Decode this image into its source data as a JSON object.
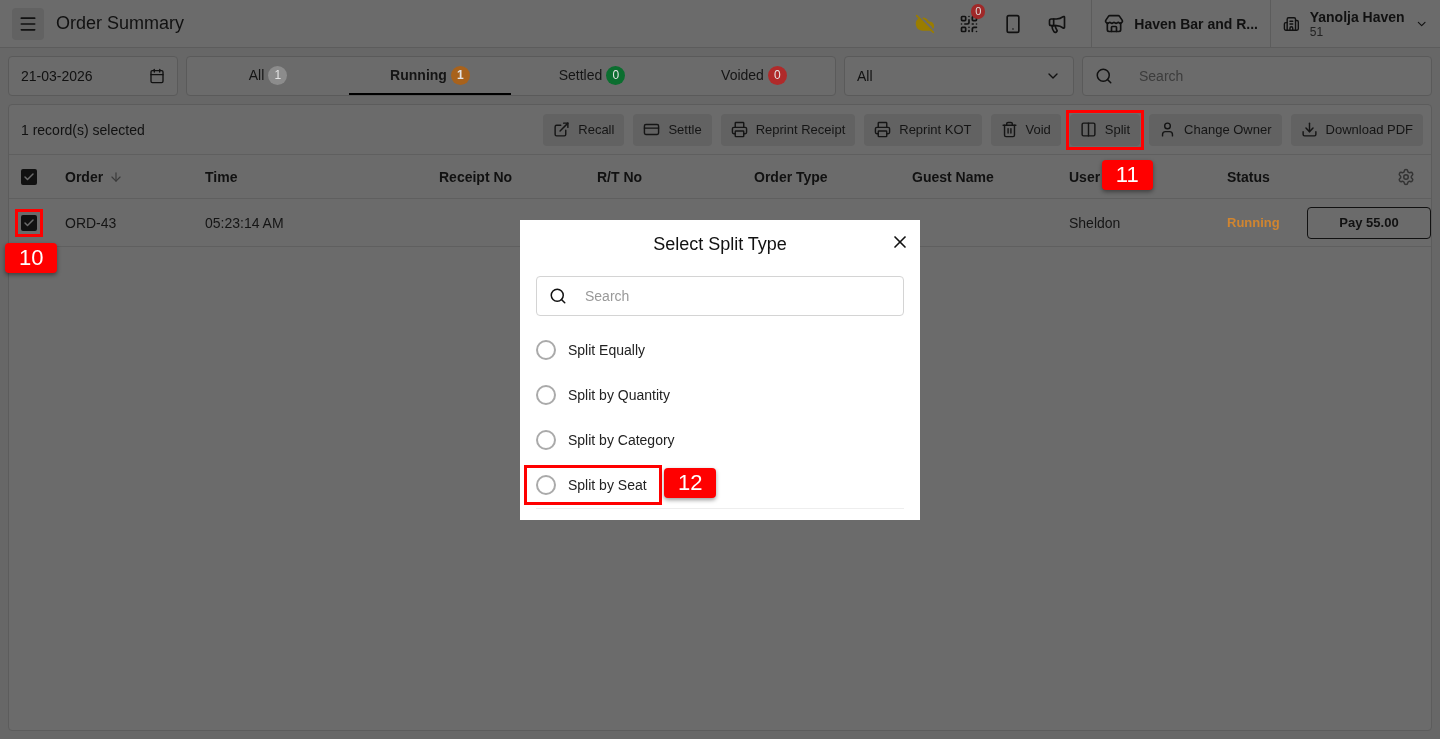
{
  "header": {
    "title": "Order Summary",
    "notifications_badge": "0",
    "outlet": "Haven Bar and R...",
    "account": {
      "name": "Yanolja Haven",
      "id": "51"
    }
  },
  "filters": {
    "date": "21-03-2026",
    "tabs": [
      {
        "label": "All",
        "count": "1",
        "color": "#8c8c8c",
        "selected": false
      },
      {
        "label": "Running",
        "count": "1",
        "color": "#a8621c",
        "selected": true
      },
      {
        "label": "Settled",
        "count": "0",
        "color": "#0b6e2f",
        "selected": false
      },
      {
        "label": "Voided",
        "count": "0",
        "color": "#b02a2a",
        "selected": false
      }
    ],
    "type_select": "All",
    "search": {
      "placeholder": "Search"
    }
  },
  "toolbar": {
    "selection": "1 record(s) selected",
    "actions": [
      {
        "label": "Recall",
        "kind": "recall",
        "highlighted": false
      },
      {
        "label": "Settle",
        "kind": "settle",
        "highlighted": false
      },
      {
        "label": "Reprint Receipt",
        "kind": "reprint",
        "highlighted": false
      },
      {
        "label": "Reprint KOT",
        "kind": "reprint",
        "highlighted": false
      },
      {
        "label": "Void",
        "kind": "void",
        "highlighted": false
      },
      {
        "label": "Split",
        "kind": "split",
        "highlighted": true,
        "callout": "11"
      },
      {
        "label": "Change Owner",
        "kind": "owner",
        "highlighted": false
      },
      {
        "label": "Download PDF",
        "kind": "download",
        "highlighted": false
      }
    ]
  },
  "table": {
    "all_checked": true,
    "columns": [
      {
        "label": "Order",
        "sorted": true
      },
      {
        "label": "Time",
        "sorted": false
      },
      {
        "label": "Receipt No",
        "sorted": false
      },
      {
        "label": "R/T No",
        "sorted": false
      },
      {
        "label": "Order Type",
        "sorted": false
      },
      {
        "label": "Guest Name",
        "sorted": false
      },
      {
        "label": "User",
        "sorted": false
      },
      {
        "label": "Status",
        "sorted": false
      }
    ],
    "rows": [
      {
        "checked": true,
        "highlighted": true,
        "callout": "10",
        "order": "ORD-43",
        "time": "05:23:14 AM",
        "user": "Sheldon",
        "status": "Running",
        "action": "Pay 55.00"
      }
    ]
  },
  "dialog": {
    "title": "Select Split Type",
    "search": {
      "placeholder": "Search"
    },
    "options": [
      {
        "label": "Split Equally",
        "selected": false,
        "highlighted": false
      },
      {
        "label": "Split by Quantity",
        "selected": false,
        "highlighted": false
      },
      {
        "label": "Split by Category",
        "selected": false,
        "highlighted": false
      },
      {
        "label": "Split by Seat",
        "selected": false,
        "highlighted": true,
        "callout": "12"
      }
    ]
  }
}
